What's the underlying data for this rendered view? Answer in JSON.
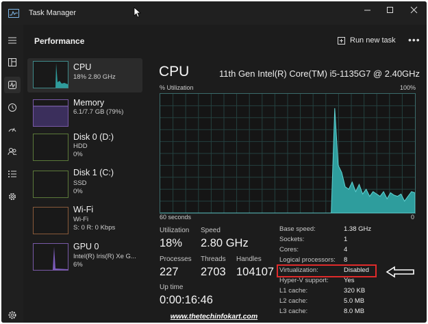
{
  "window": {
    "title": "Task Manager",
    "accent": "#40c4c4",
    "alert_color": "#e02a2a"
  },
  "header": {
    "section": "Performance",
    "run_task": "Run new task",
    "more": "•••"
  },
  "rail": {
    "icons": [
      "hamburger-icon",
      "processes-icon",
      "performance-icon",
      "app-history-icon",
      "startup-apps-icon",
      "users-icon",
      "details-icon",
      "services-icon",
      "settings-icon"
    ]
  },
  "devices": [
    {
      "name": "CPU",
      "sub1": "18% 2.80 GHz",
      "sub2": ""
    },
    {
      "name": "Memory",
      "sub1": "6.1/7.7 GB (79%)",
      "sub2": ""
    },
    {
      "name": "Disk 0 (D:)",
      "sub1": "HDD",
      "sub2": "0%"
    },
    {
      "name": "Disk 1 (C:)",
      "sub1": "SSD",
      "sub2": "0%"
    },
    {
      "name": "Wi-Fi",
      "sub1": "Wi-Fi",
      "sub2": "S: 0 R: 0 Kbps"
    },
    {
      "name": "GPU 0",
      "sub1": "Intel(R) Iris(R) Xe G...",
      "sub2": "6%"
    }
  ],
  "main": {
    "title": "CPU",
    "model": "11th Gen Intel(R) Core(TM) i5-1135G7 @ 2.40GHz",
    "graph_label": "% Utilization",
    "graph_max": "100%",
    "graph_time": "60 seconds",
    "graph_zero": "0",
    "utilization_series": [
      0,
      0,
      0,
      0,
      0,
      0,
      0,
      0,
      0,
      0,
      0,
      0,
      0,
      0,
      0,
      0,
      0,
      0,
      0,
      0,
      0,
      0,
      0,
      0,
      0,
      0,
      0,
      0,
      0,
      0,
      0,
      0,
      0,
      0,
      0,
      0,
      0,
      0,
      0,
      0,
      0,
      0,
      0,
      0,
      0,
      0,
      0,
      0,
      0,
      0,
      88,
      40,
      34,
      22,
      20,
      26,
      18,
      24,
      16,
      20,
      14,
      18,
      16,
      14,
      18,
      12,
      17,
      15,
      14,
      16,
      10,
      14,
      18,
      17
    ]
  },
  "stats": {
    "utilization_label": "Utilization",
    "utilization": "18%",
    "speed_label": "Speed",
    "speed": "2.80 GHz",
    "processes_label": "Processes",
    "processes": "227",
    "threads_label": "Threads",
    "threads": "2703",
    "handles_label": "Handles",
    "handles": "104107",
    "uptime_label": "Up time",
    "uptime": "0:00:16:46"
  },
  "specs": [
    {
      "k": "Base speed:",
      "v": "1.38 GHz"
    },
    {
      "k": "Sockets:",
      "v": "1"
    },
    {
      "k": "Cores:",
      "v": "4"
    },
    {
      "k": "Logical processors:",
      "v": "8"
    },
    {
      "k": "Virtualization:",
      "v": "Disabled"
    },
    {
      "k": "Hyper-V support:",
      "v": "Yes"
    },
    {
      "k": "L1 cache:",
      "v": "320 KB"
    },
    {
      "k": "L2 cache:",
      "v": "5.0 MB"
    },
    {
      "k": "L3 cache:",
      "v": "8.0 MB"
    }
  ],
  "watermark": "www.thetechinfokart.com"
}
